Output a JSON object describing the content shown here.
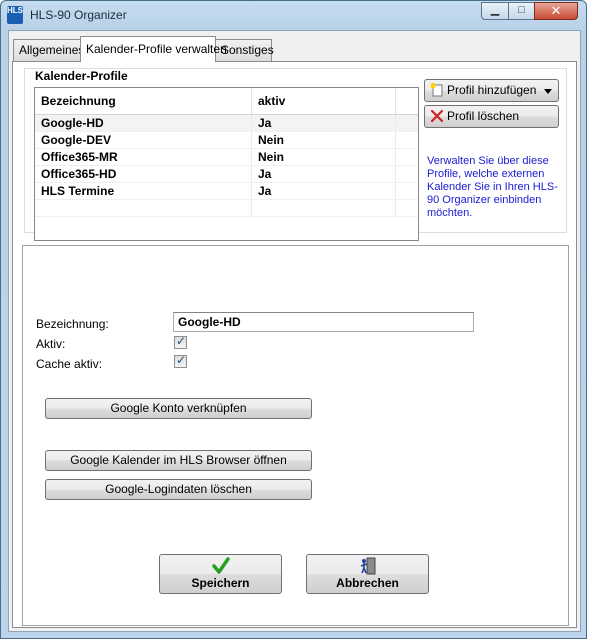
{
  "window": {
    "title": "HLS-90 Organizer",
    "app_icon_text": "HLS",
    "minimize_glyph": "▁",
    "maximize_glyph": "□",
    "close_glyph": "✕"
  },
  "tabs": [
    {
      "label": "Allgemeines",
      "active": false
    },
    {
      "label": "Kalender-Profile verwalten",
      "active": true
    },
    {
      "label": "Sonstiges",
      "active": false
    }
  ],
  "profiles": {
    "group_title": "Kalender-Profile",
    "columns": [
      "Bezeichnung",
      "aktiv"
    ],
    "rows": [
      {
        "name": "Google-HD",
        "active": "Ja"
      },
      {
        "name": "Google-DEV",
        "active": "Nein"
      },
      {
        "name": "Office365-MR",
        "active": "Nein"
      },
      {
        "name": "Office365-HD",
        "active": "Ja"
      },
      {
        "name": "HLS Termine",
        "active": "Ja"
      }
    ],
    "add_button": "Profil hinzufügen",
    "delete_button": "Profil löschen",
    "info_text": "Verwalten Sie über diese Profile, welche externen Kalender Sie in Ihren HLS-90 Organizer einbinden möchten."
  },
  "details": {
    "name_label": "Bezeichnung:",
    "name_value": "Google-HD",
    "active_label": "Aktiv:",
    "cache_label": "Cache aktiv:",
    "link_account_button": "Google Konto verknüpfen",
    "open_browser_button": "Google Kalender im HLS Browser öffnen",
    "delete_login_button": "Google-Logindaten löschen"
  },
  "footer": {
    "save_label": "Speichern",
    "cancel_label": "Abbrechen"
  },
  "colors": {
    "info_text": "#1a1ad4",
    "save_icon": "#27a020",
    "delete_icon": "#d22020"
  }
}
